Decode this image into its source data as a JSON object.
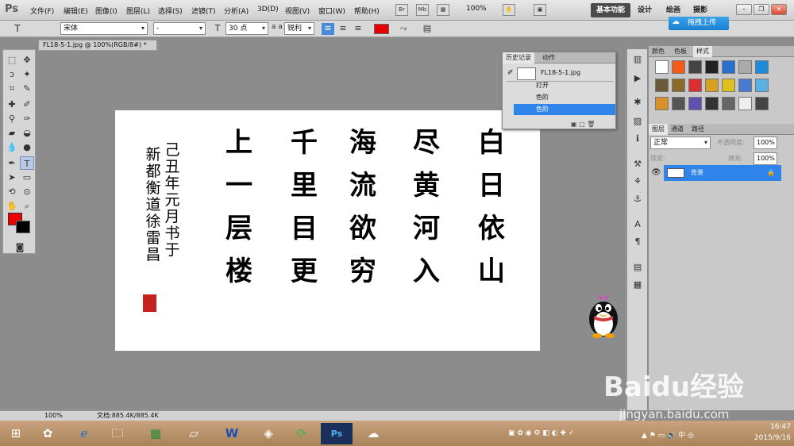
{
  "app": {
    "logo": "Ps"
  },
  "menu": [
    "文件(F)",
    "编辑(E)",
    "图像(I)",
    "图层(L)",
    "选择(S)",
    "滤镜(T)",
    "分析(A)",
    "3D(D)",
    "视图(V)",
    "窗口(W)",
    "帮助(H)"
  ],
  "menubar_buttons": [
    "Br",
    "Mb"
  ],
  "zoom": "100%",
  "workspaces": {
    "basic": "基本功能",
    "design": "设计",
    "paint": "绘画",
    "photo": "摄影"
  },
  "upload": {
    "label": "拖拽上传"
  },
  "options": {
    "tool_icon": "T",
    "font_family": "宋体",
    "font_style": "-",
    "size_icon": "T",
    "font_size": "30 点",
    "aa_icon": "a a",
    "anti_alias": "锐利",
    "swatch_color": "#e60000"
  },
  "document": {
    "tab": "FL18-5-1.jpg @ 100%(RGB/8#) *",
    "status": "文档:885.4K/885.4K",
    "zoom": "100%"
  },
  "calligraphy": {
    "col1": "白日依山",
    "col2": "尽黄河入",
    "col3": "海流欲穷",
    "col4": "千里目更",
    "col5": "上一层楼",
    "sig1": "己丑年元月书于",
    "sig2": "新都衡道徐雷昌"
  },
  "history": {
    "tabs": [
      "历史记录",
      "动作"
    ],
    "snapshot": "FL18-5-1.jpg",
    "items": [
      "打开",
      "色阶",
      "色阶"
    ]
  },
  "swatch_panel": {
    "tabs": [
      "颜色",
      "色板",
      "样式"
    ]
  },
  "layers_panel": {
    "tabs": [
      "图层",
      "通道",
      "路径"
    ],
    "blend": "正常",
    "opacity_label": "不透明度:",
    "opacity": "100%",
    "lock_label": "锁定:",
    "fill_label": "填充:",
    "fill": "100%",
    "layer_name": "背景"
  },
  "taskbar": {
    "time": "16:47",
    "date": "2015/9/16"
  },
  "watermark": {
    "brand": "Baidu经验",
    "url": "jingyan.baidu.com"
  },
  "colors": {
    "accent": "#2e84e8",
    "fg": "#ee0000",
    "bg": "#000000"
  }
}
